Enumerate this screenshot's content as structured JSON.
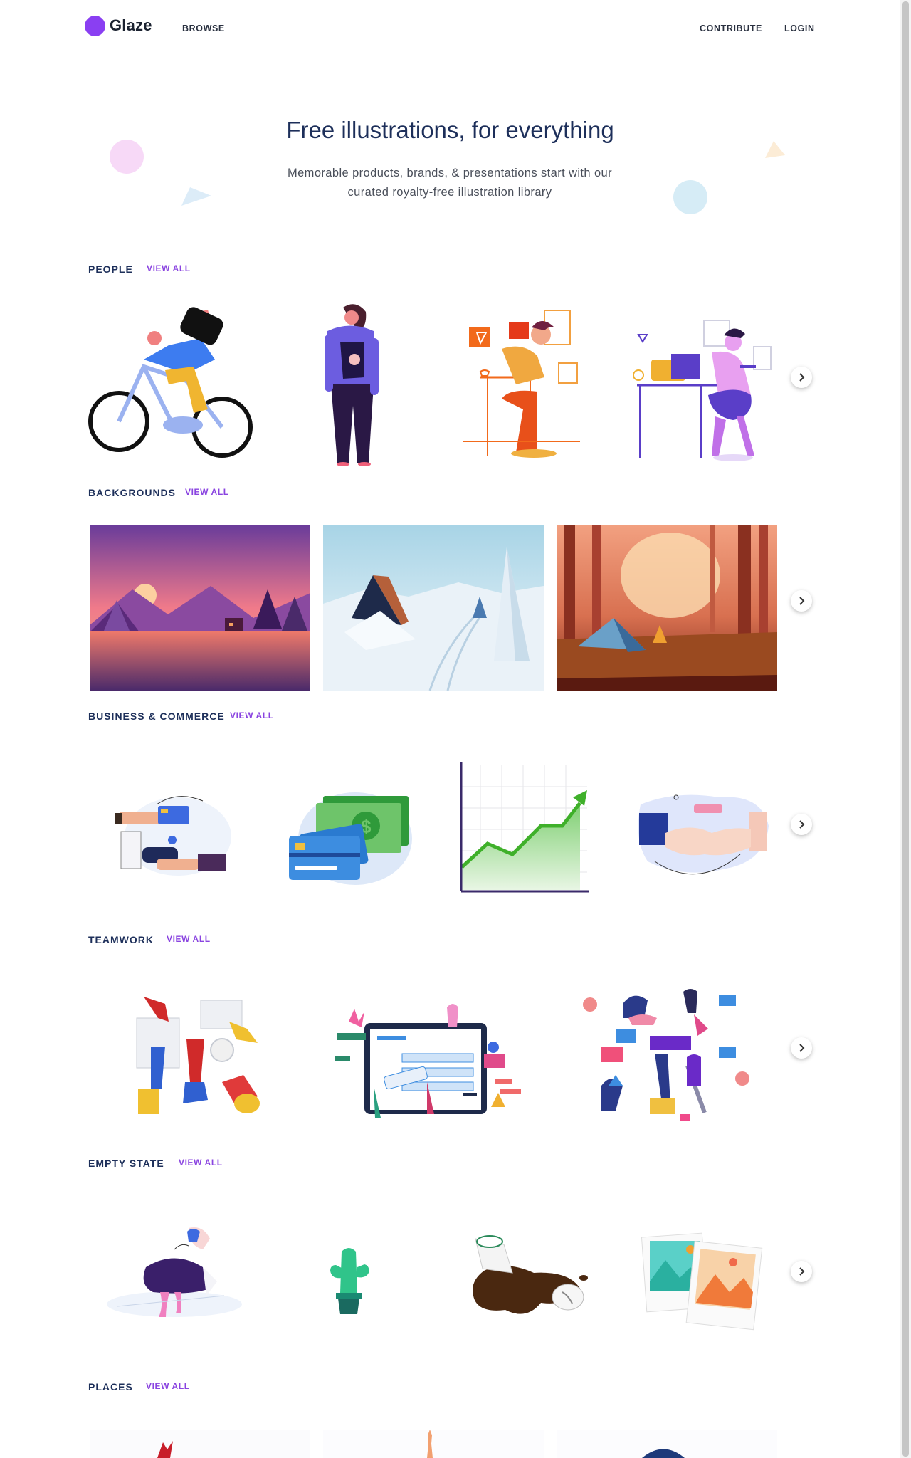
{
  "header": {
    "logo_text": "Glaze",
    "nav_browse": "BROWSE",
    "nav_contribute": "CONTRIBUTE",
    "nav_login": "LOGIN"
  },
  "hero": {
    "title": "Free illustrations, for everything",
    "subtitle": "Memorable products, brands, & presentations start with our curated royalty-free illustration library"
  },
  "sections": [
    {
      "title": "PEOPLE",
      "link": "VIEW ALL"
    },
    {
      "title": "BACKGROUNDS",
      "link": "VIEW ALL"
    },
    {
      "title": "BUSINESS & COMMERCE",
      "link": "VIEW ALL"
    },
    {
      "title": "TEAMWORK",
      "link": "VIEW ALL"
    },
    {
      "title": "EMPTY STATE",
      "link": "VIEW ALL"
    },
    {
      "title": "PLACES",
      "link": "VIEW ALL"
    }
  ],
  "icons": {
    "next": "chevron-right-icon"
  },
  "colors": {
    "accent": "#8a3ff2",
    "link": "#8a44e0",
    "heading": "#1d2f5a"
  }
}
